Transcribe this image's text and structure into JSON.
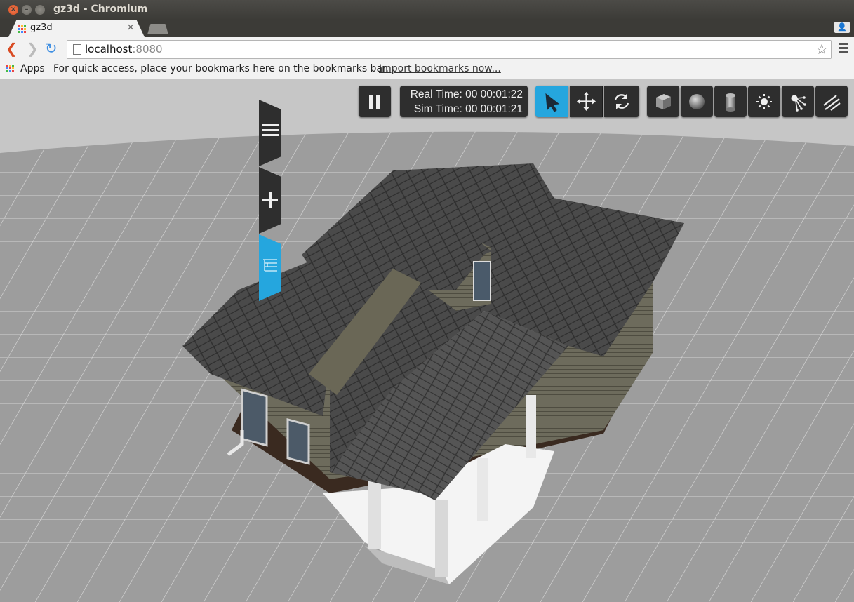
{
  "window": {
    "title": "gz3d - Chromium",
    "close_glyph": "×",
    "minimize_glyph": "–",
    "maximize_glyph": "□"
  },
  "tabs": [
    {
      "label": "gz3d",
      "favicon": "apps-grid-icon"
    }
  ],
  "toolbar": {
    "address_host": "localhost",
    "address_port": ":8080",
    "back_icon": "back-arrow-icon",
    "forward_icon": "forward-arrow-icon",
    "reload_icon": "reload-icon",
    "bookmark_icon": "star-icon",
    "menu_icon": "hamburger-menu-icon"
  },
  "bookmarks_bar": {
    "apps_label": "Apps",
    "hint": "For quick access, place your bookmarks here on the bookmarks bar.",
    "import_link": "Import bookmarks now..."
  },
  "gz3d": {
    "clock": {
      "real_time": "Real Time: 00 00:01:22",
      "sim_time": "Sim Time: 00 00:01:21"
    },
    "play_state": "paused",
    "manipulation_modes": [
      {
        "name": "select",
        "icon": "cursor-arrow-icon",
        "active": true
      },
      {
        "name": "translate",
        "icon": "move-arrows-icon",
        "active": false
      },
      {
        "name": "rotate",
        "icon": "rotate-icon",
        "active": false
      }
    ],
    "insert_shapes": [
      {
        "name": "box",
        "icon": "cube-icon"
      },
      {
        "name": "sphere",
        "icon": "sphere-icon"
      },
      {
        "name": "cylinder",
        "icon": "cylinder-icon"
      },
      {
        "name": "point-light",
        "icon": "sun-icon"
      },
      {
        "name": "spot-light",
        "icon": "spotlight-icon"
      },
      {
        "name": "directional-light",
        "icon": "directional-light-icon"
      }
    ],
    "side_menu": [
      {
        "name": "menu",
        "icon": "hamburger-icon",
        "active": false
      },
      {
        "name": "insert",
        "icon": "plus-icon",
        "active": false
      },
      {
        "name": "tree",
        "icon": "tree-list-icon",
        "active": true
      }
    ],
    "colors": {
      "accent": "#25a6de",
      "button_bg": "#2e2e2e",
      "ground": "#9a9a9a",
      "sky": "#c8c8c8"
    }
  }
}
